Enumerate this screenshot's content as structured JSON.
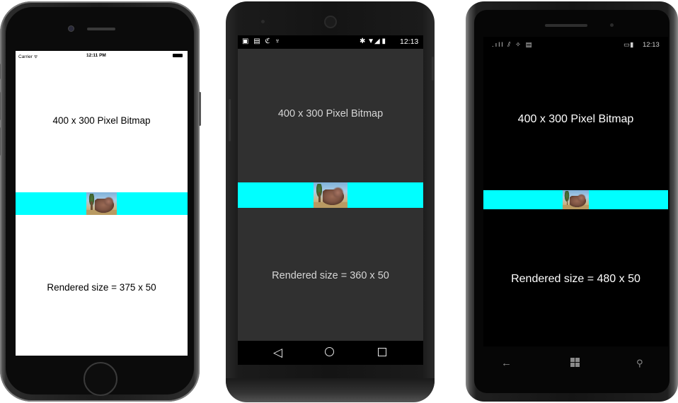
{
  "colors": {
    "band": "#00ffff",
    "ios_screen_bg": "#ffffff",
    "android_screen_bg": "#303030",
    "wp_screen_bg": "#000000"
  },
  "ios": {
    "status": {
      "carrier": "Carrier ᯤ",
      "time": "12:11 PM"
    },
    "title": "400 x 300 Pixel Bitmap",
    "rendered": "Rendered size = 375 x 50"
  },
  "android": {
    "status": {
      "icons_left": "▣ ▤ ℭ ♆",
      "icons_right": "✱ ▼◢ ▮",
      "time": "12:13"
    },
    "title": "400 x 300 Pixel Bitmap",
    "rendered": "Rendered size = 360 x 50",
    "nav": {
      "back": "◁"
    }
  },
  "windows_phone": {
    "status": {
      "icons_left": ".ıll ⫽ ✧ ▤",
      "battery": "▭▮",
      "time": "12:13"
    },
    "title": "400 x 300 Pixel Bitmap",
    "rendered": "Rendered size = 480 x 50",
    "nav": {
      "back": "←",
      "search": "⚲"
    }
  },
  "icons": {
    "ios_home_button": "home-button",
    "android_nav": [
      "back-icon",
      "home-icon",
      "recent-apps-icon"
    ],
    "wp_nav": [
      "back-icon",
      "windows-start-icon",
      "search-icon"
    ]
  }
}
